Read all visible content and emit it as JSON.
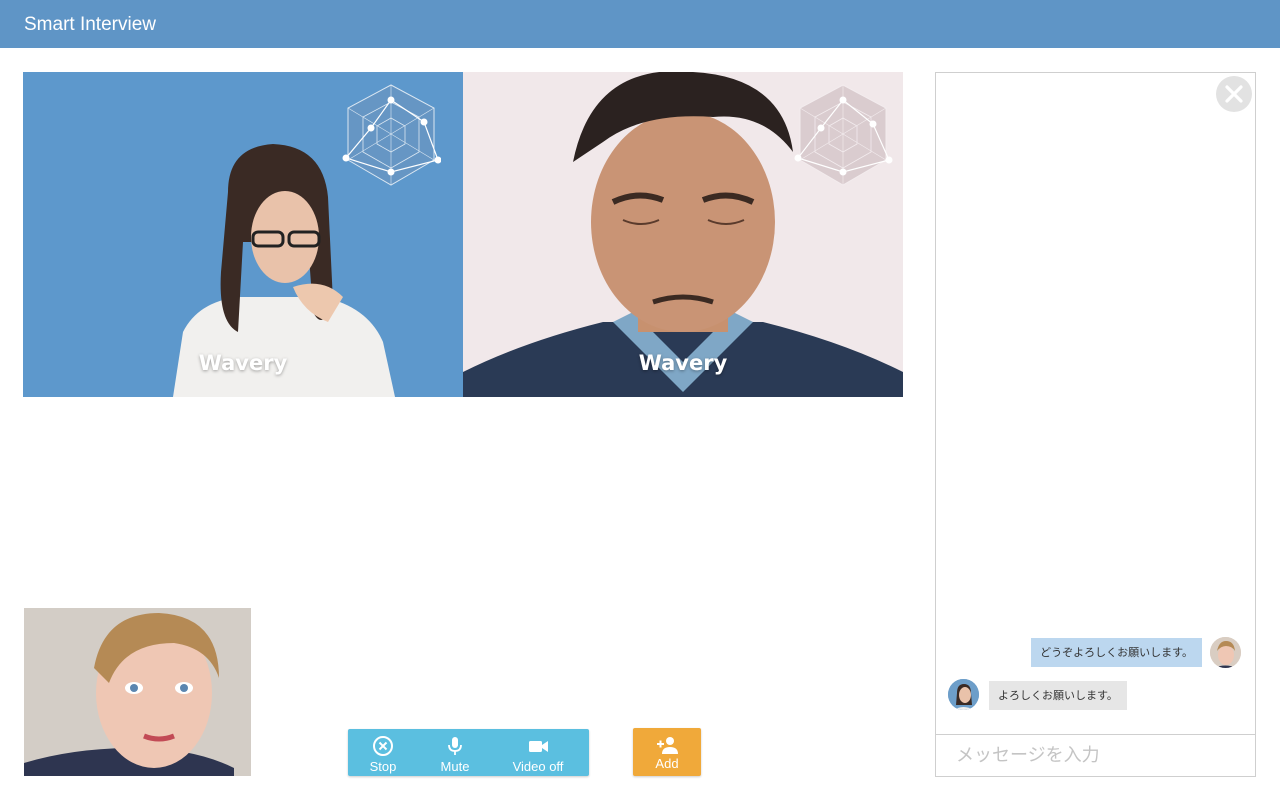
{
  "app": {
    "title": "Smart Interview"
  },
  "videos": [
    {
      "name": "Wavery"
    },
    {
      "name": "Wavery"
    }
  ],
  "controls": {
    "stop": {
      "label": "Stop",
      "icon": "stop-circle-icon"
    },
    "mute": {
      "label": "Mute",
      "icon": "microphone-icon"
    },
    "video": {
      "label": "Video off",
      "icon": "video-camera-icon"
    }
  },
  "add": {
    "label": "Add",
    "icon": "add-person-icon"
  },
  "chat": {
    "messages": [
      {
        "text": "どうぞよろしくお願いします。",
        "direction": "outgoing"
      },
      {
        "text": "よろしくお願いします。",
        "direction": "incoming"
      }
    ],
    "input_placeholder": "メッセージを入力"
  },
  "colors": {
    "header": "#5f95c6",
    "controls": "#5bbfe0",
    "add": "#f0a93a",
    "outgoing_bubble": "#bcd7ef",
    "incoming_bubble": "#e6e6e6"
  }
}
